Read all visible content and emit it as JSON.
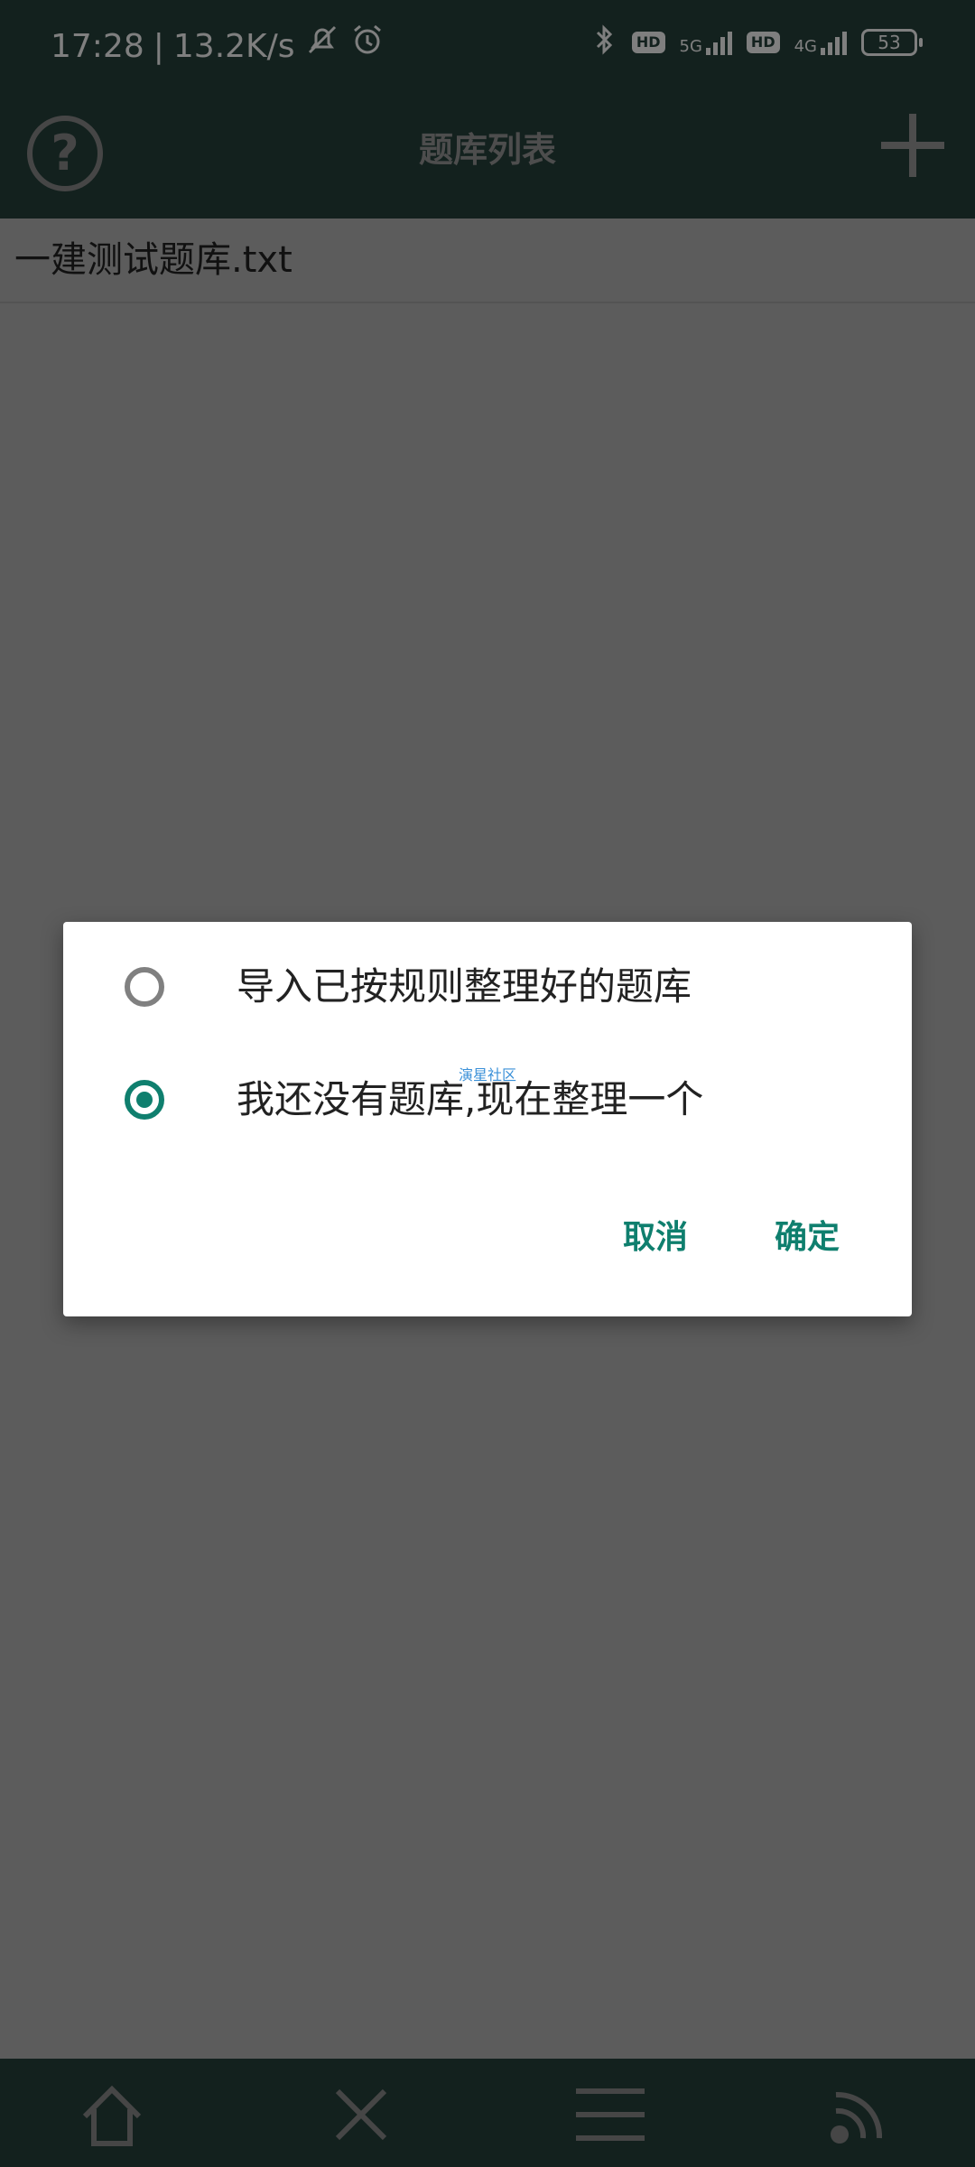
{
  "status": {
    "time": "17:28",
    "separator": "|",
    "speed": "13.2K/s",
    "net1": "5G",
    "net2": "4G",
    "hd": "HD",
    "battery": "53"
  },
  "appbar": {
    "title": "题库列表"
  },
  "list": {
    "items": [
      "一建测试题库.txt"
    ]
  },
  "dialog": {
    "options": [
      {
        "label": "导入已按规则整理好的题库",
        "selected": false
      },
      {
        "label": "我还没有题库,现在整理一个",
        "selected": true
      }
    ],
    "watermark": "演星社区",
    "cancel": "取消",
    "ok": "确定",
    "accent": "#0f7f6e"
  },
  "bottom_nav": {
    "icons": [
      "home-icon",
      "close-icon",
      "menu-icon",
      "rss-icon"
    ]
  }
}
